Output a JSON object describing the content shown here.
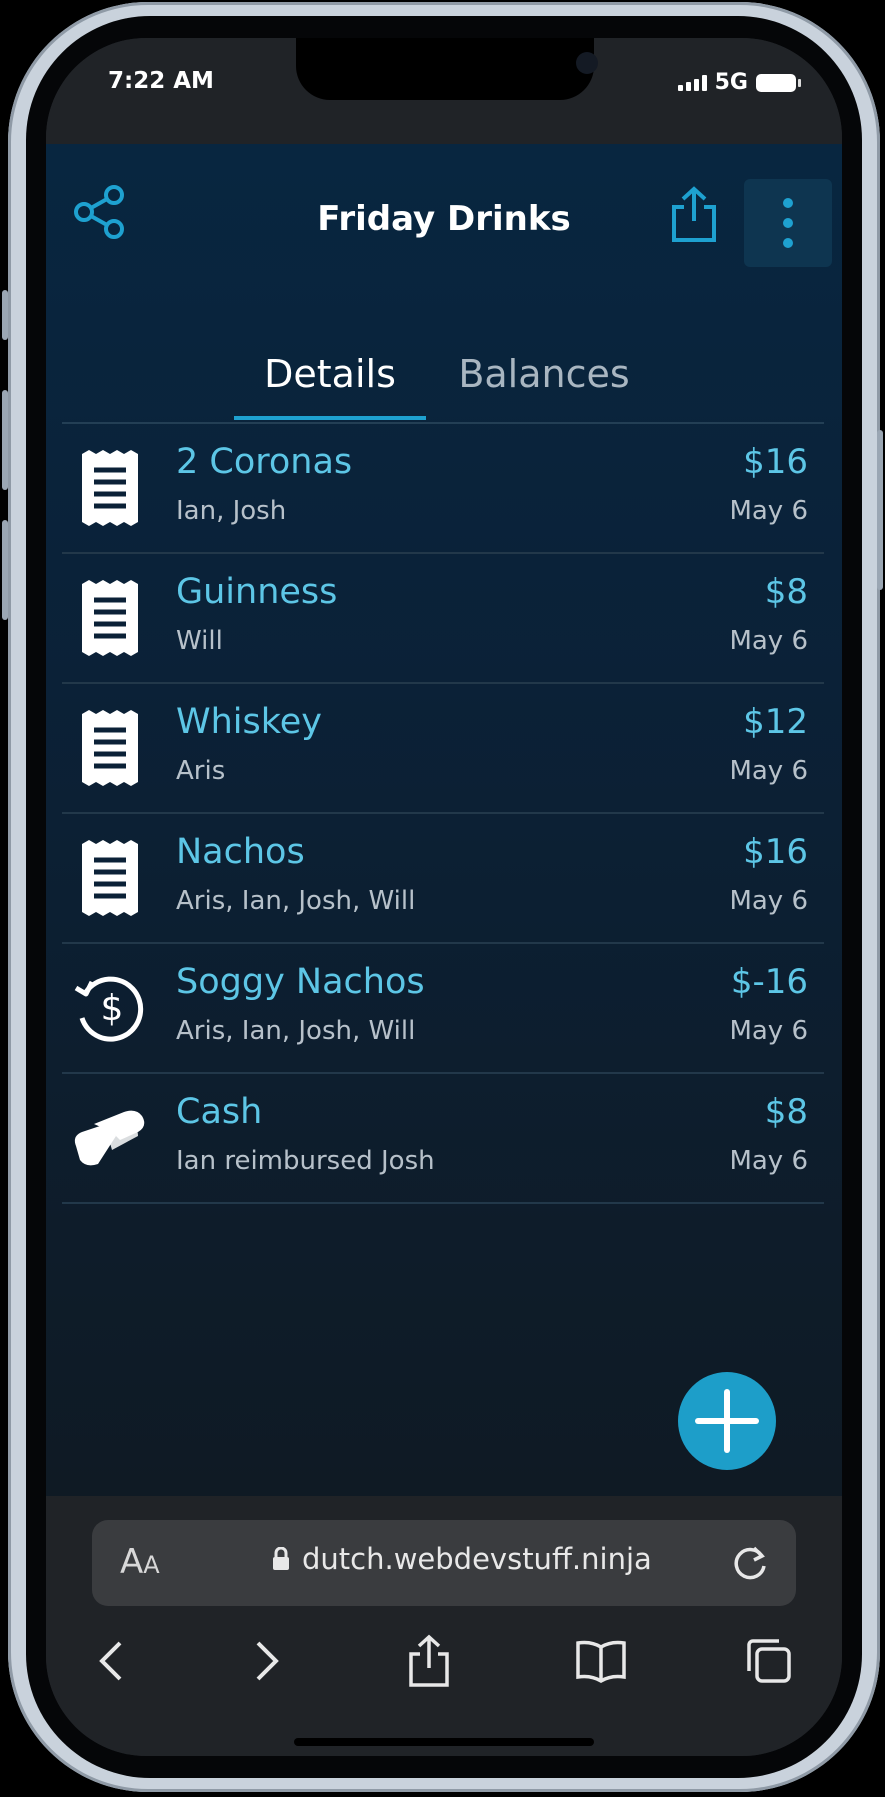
{
  "status": {
    "time": "7:22 AM",
    "network": "5G"
  },
  "header": {
    "title": "Friday Drinks"
  },
  "tabs": [
    {
      "label": "Details",
      "active": true
    },
    {
      "label": "Balances",
      "active": false
    }
  ],
  "transactions": [
    {
      "icon": "receipt-icon",
      "title": "2 Coronas",
      "people": "Ian, Josh",
      "amount": "$16",
      "date": "May 6"
    },
    {
      "icon": "receipt-icon",
      "title": "Guinness",
      "people": "Will",
      "amount": "$8",
      "date": "May 6"
    },
    {
      "icon": "receipt-icon",
      "title": "Whiskey",
      "people": "Aris",
      "amount": "$12",
      "date": "May 6"
    },
    {
      "icon": "receipt-icon",
      "title": "Nachos",
      "people": "Aris, Ian, Josh, Will",
      "amount": "$16",
      "date": "May 6"
    },
    {
      "icon": "refund-icon",
      "title": "Soggy Nachos",
      "people": "Aris, Ian, Josh, Will",
      "amount": "$-16",
      "date": "May 6"
    },
    {
      "icon": "handshake-icon",
      "title": "Cash",
      "people": "Ian reimbursed Josh",
      "amount": "$8",
      "date": "May 6"
    }
  ],
  "browser": {
    "aa_large": "A",
    "aa_small": "A",
    "url": "dutch.webdevstuff.ninja"
  },
  "colors": {
    "accent": "#5dc6e6",
    "fab": "#1d9ec9",
    "app_bg": "#082640"
  }
}
